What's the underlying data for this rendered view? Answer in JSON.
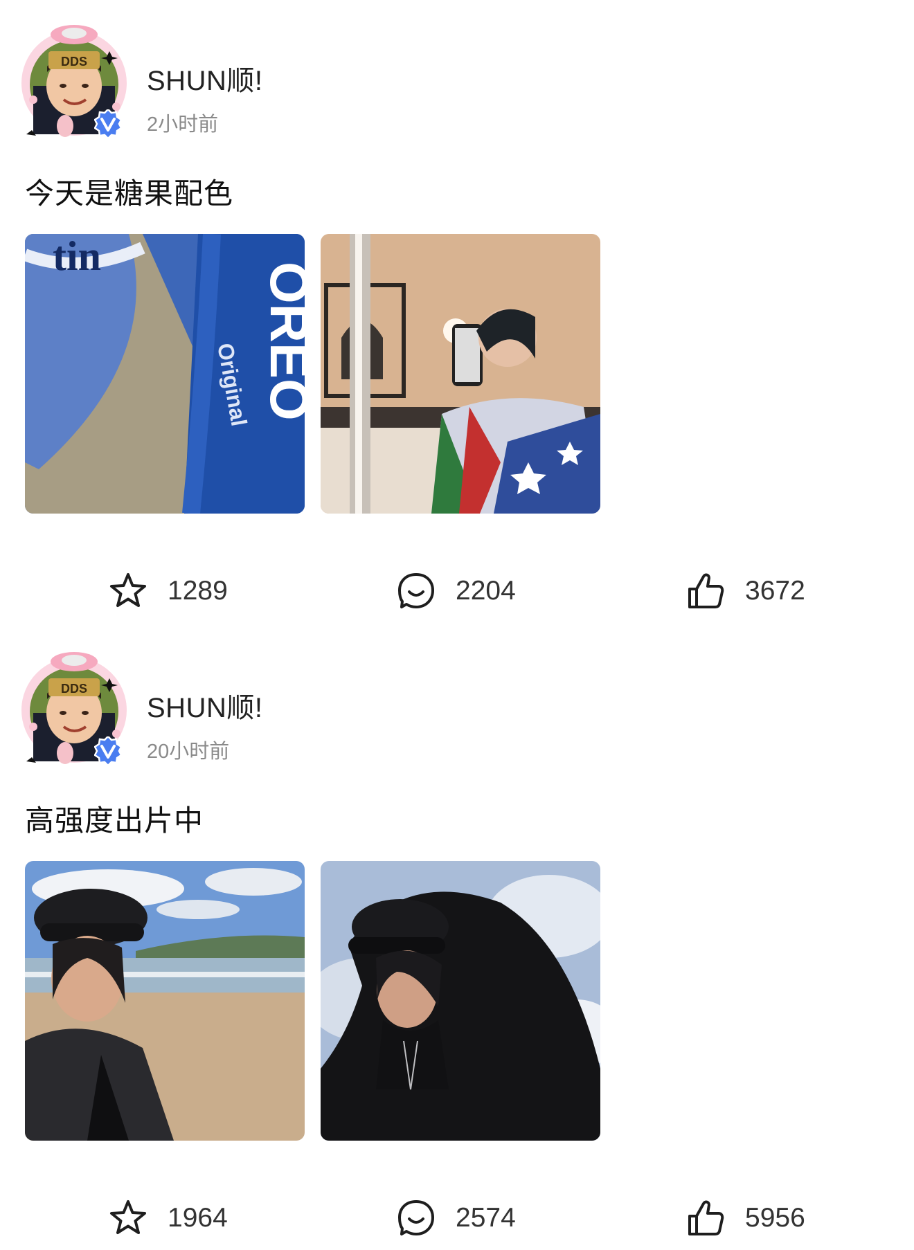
{
  "posts": [
    {
      "author": "SHUN顺!",
      "time": "2小时前",
      "caption": "今天是糖果配色",
      "images": [
        "oreo-photo",
        "mirror-selfie-photo"
      ],
      "stats": {
        "favorites": "1289",
        "comments": "2204",
        "likes": "3672"
      }
    },
    {
      "author": "SHUN顺!",
      "time": "20小时前",
      "caption": "高强度出片中",
      "images": [
        "beach-selfie-photo",
        "sky-selfie-photo"
      ],
      "stats": {
        "favorites": "1964",
        "comments": "2574",
        "likes": "5956"
      }
    }
  ],
  "icons": {
    "favorite": "star-icon",
    "comment": "comment-icon",
    "like": "thumbs-up-icon",
    "verified": "verified-badge-icon"
  },
  "colors": {
    "verified": "#4a7df0",
    "text_secondary": "#8a8a8a"
  }
}
